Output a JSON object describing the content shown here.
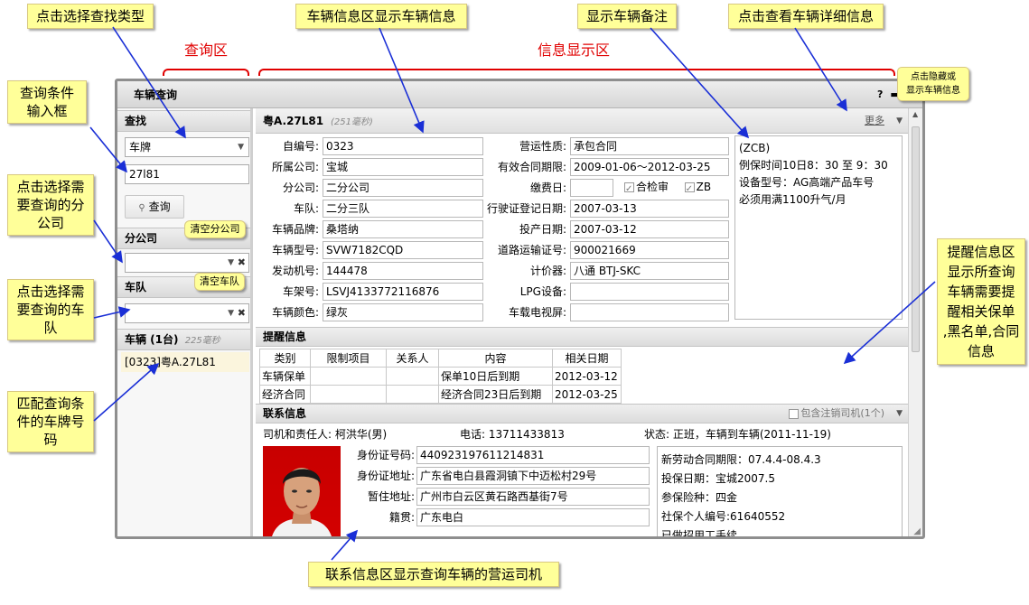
{
  "annotations": {
    "region_query": "查询区",
    "region_info": "信息显示区",
    "c1": "点击选择查找类型",
    "c2": "查询条件\n输入框",
    "c3": "点击选择需\n要查询的分\n公司",
    "c4": "点击选择需\n要查询的车\n队",
    "c5": "匹配查询条\n件的车牌号\n码",
    "c6": "车辆信息区显示车辆信息",
    "c7": "显示车辆备注",
    "c8": "点击查看车辆详细信息",
    "c9": "点击隐藏或\n显示车辆信息",
    "c10": "提醒信息区\n显示所查询\n车辆需要提\n醒相关保单\n,黑名单,合同\n信息",
    "c11": "联系信息区显示查询车辆的营运司机",
    "bubble_clear_branch": "清空分公司",
    "bubble_clear_team": "清空车队"
  },
  "window": {
    "title": "车辆查询",
    "help": "?",
    "minimize": "▬",
    "popout": "⇱"
  },
  "left": {
    "find_header": "查找",
    "find_type": "车牌",
    "query_value": "27l81",
    "query_button": "查询",
    "branch_header": "分公司",
    "branch_value": "",
    "team_header": "车队",
    "team_value": "",
    "vehicles_header": "车辆 (1台)",
    "vehicles_ms": "225毫秒",
    "vehicles": [
      "[0323]粤A.27L81"
    ]
  },
  "vehicle": {
    "plate": "粤A.27L81",
    "ms": "(251毫秒)",
    "more": "更多",
    "fields_left": [
      {
        "label": "自编号:",
        "value": "0323"
      },
      {
        "label": "所属公司:",
        "value": "宝城"
      },
      {
        "label": "分公司:",
        "value": "二分公司"
      },
      {
        "label": "车队:",
        "value": "二分三队"
      },
      {
        "label": "车辆品牌:",
        "value": "桑塔纳"
      },
      {
        "label": "车辆型号:",
        "value": "SVW7182CQD"
      },
      {
        "label": "发动机号:",
        "value": "144478"
      },
      {
        "label": "车架号:",
        "value": "LSVJ4133772116876"
      },
      {
        "label": "车辆颜色:",
        "value": "绿灰"
      }
    ],
    "fields_right": [
      {
        "label": "营运性质:",
        "value": "承包合同"
      },
      {
        "label": "有效合同期限:",
        "value": "2009-01-06～2012-03-25"
      },
      {
        "label": "缴费日:",
        "value": ""
      },
      {
        "label": "行驶证登记日期:",
        "value": "2007-03-13"
      },
      {
        "label": "投产日期:",
        "value": "2007-03-12"
      },
      {
        "label": "道路运输证号:",
        "value": "900021669"
      },
      {
        "label": "计价器:",
        "value": "八通 BTJ-SKC"
      },
      {
        "label": "LPG设备:",
        "value": ""
      },
      {
        "label": "车载电视屏:",
        "value": ""
      }
    ],
    "check_inspect": "合检审",
    "check_zb": "ZB",
    "note": "(ZCB)\n例保时间10日8：30 至  9：30\n设备型号：AG高端产品车号\n必须用满1100升气/月"
  },
  "reminder": {
    "header": "提醒信息",
    "columns": [
      "类别",
      "限制项目",
      "关系人",
      "内容",
      "相关日期"
    ],
    "rows": [
      [
        "车辆保单",
        "",
        "",
        "保单10日后到期",
        "2012-03-12"
      ],
      [
        "经济合同",
        "",
        "",
        "经济合同23日后到期",
        "2012-03-25"
      ]
    ]
  },
  "contact": {
    "header": "联系信息",
    "include_cancelled": "包含注销司机(1个)",
    "driver_line": "司机和责任人: 柯洪华(男)",
    "phone_line": "电话: 13711433813",
    "status_line": "状态: 正班，车辆到车辆(2011-11-19)",
    "fields": [
      {
        "label": "身份证号码:",
        "value": "440923197611214831"
      },
      {
        "label": "身份证地址:",
        "value": "广东省电白县霞洞镇下中迈松村29号"
      },
      {
        "label": "暂住地址:",
        "value": "广州市白云区黄石路西基街7号"
      },
      {
        "label": "籍贯:",
        "value": "广东电白"
      }
    ],
    "extra": "新劳动合同期限：07.4.4-08.4.3\n投保日期：宝城2007.5\n参保险种：四金\n社保个人编号:61640552\n已做招用工手续"
  },
  "colors": {
    "callout_bg": "#ffff99",
    "region_red": "#e00000",
    "arrow_blue": "#1a2fd6"
  }
}
